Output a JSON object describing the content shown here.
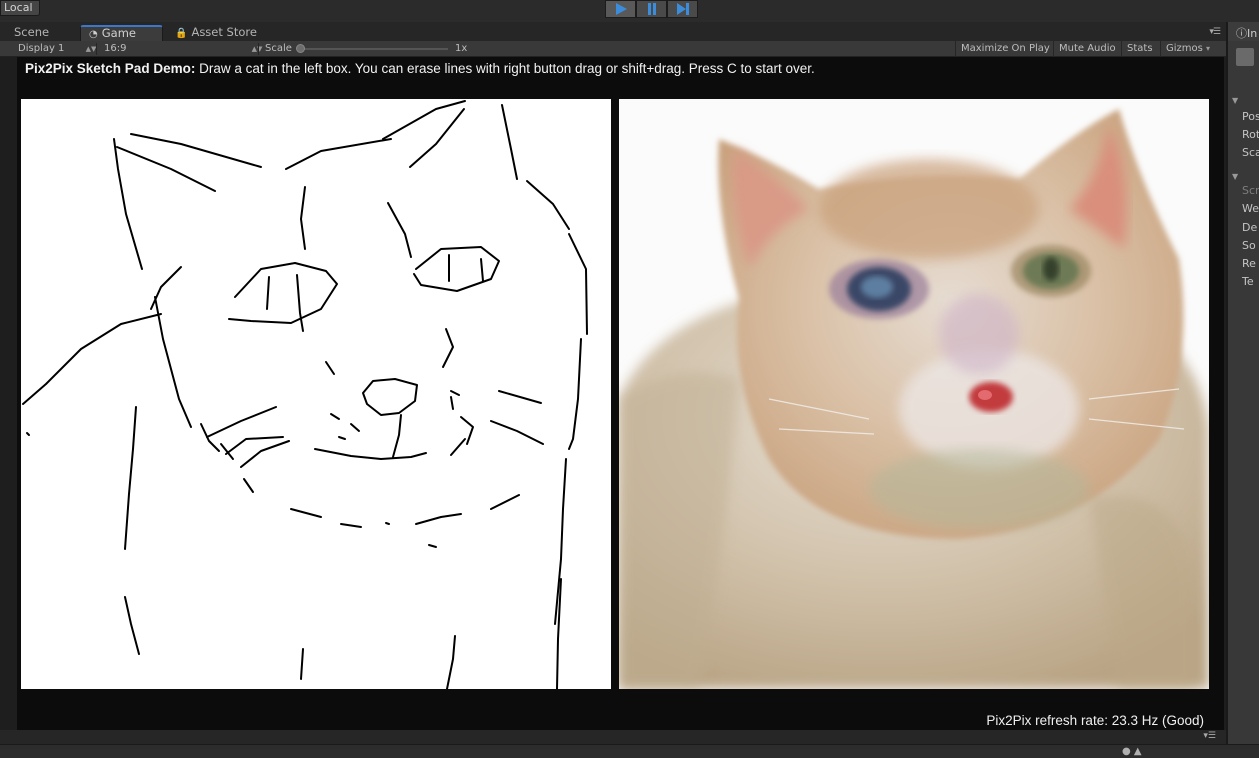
{
  "toolbar": {
    "collab_label": "Local",
    "play_mode_active": true
  },
  "tabs": [
    {
      "label": "Scene",
      "icon": "scene-icon",
      "active": false
    },
    {
      "label": "Game",
      "icon": "game-controller-icon",
      "active": true
    },
    {
      "label": "Asset Store",
      "icon": "lock-icon",
      "active": false
    }
  ],
  "game_toolbar": {
    "display": "Display 1",
    "aspect": "16:9",
    "scale_label": "Scale",
    "scale_value": "1x",
    "maximize_on_play": "Maximize On Play",
    "mute_audio": "Mute Audio",
    "stats": "Stats",
    "gizmos": "Gizmos"
  },
  "game": {
    "instructions_title": "Pix2Pix Sketch Pad Demo:",
    "instructions_text": " Draw a cat in the left box. You can erase lines with right button drag or shift+drag. Press C to start over.",
    "refresh_rate": "Pix2Pix refresh rate: 23.3 Hz (Good)"
  },
  "inspector": {
    "tab_label": "In",
    "rows": [
      "Pos",
      "Rot",
      "Sca",
      "Scr",
      "We",
      "De",
      "So",
      "Re",
      "Te"
    ]
  },
  "colors": {
    "play_accent": "#3b8ddb",
    "tab_accent": "#3b78c9"
  }
}
